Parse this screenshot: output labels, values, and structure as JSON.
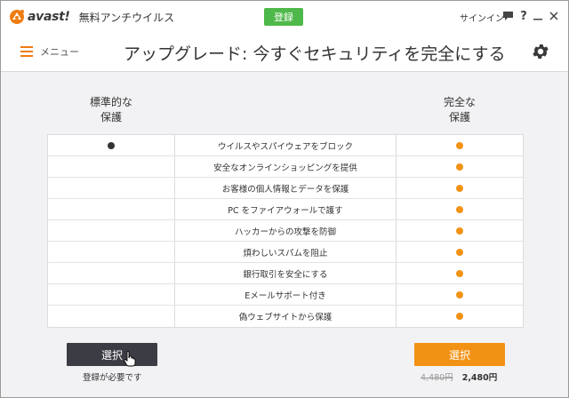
{
  "titlebar": {
    "logo_text": "avast!",
    "product_name": "無料アンチウイルス",
    "register_label": "登録",
    "signin_label": "サインイン",
    "icons": [
      "chat-icon",
      "help-icon",
      "minimize-icon",
      "close-icon"
    ]
  },
  "header": {
    "menu_label": "メニュー",
    "title": "アップグレード: 今すぐセキュリティを完全にする",
    "settings_icon": "gear-icon"
  },
  "columns": {
    "standard": {
      "title_line1": "標準的な",
      "title_line2": "保護"
    },
    "complete": {
      "title_line1": "完全な",
      "title_line2": "保護"
    }
  },
  "features": [
    {
      "label": "ウイルスやスパイウェアをブロック",
      "standard": true,
      "complete": true
    },
    {
      "label": "安全なオンラインショッピングを提供",
      "standard": false,
      "complete": true
    },
    {
      "label": "お客様の個人情報とデータを保護",
      "standard": false,
      "complete": true
    },
    {
      "label": "PC をファイアウォールで護す",
      "standard": false,
      "complete": true
    },
    {
      "label": "ハッカーからの攻撃を防御",
      "standard": false,
      "complete": true
    },
    {
      "label": "煩わしいスパムを阻止",
      "standard": false,
      "complete": true
    },
    {
      "label": "銀行取引を安全にする",
      "standard": false,
      "complete": true
    },
    {
      "label": "Eメールサポート付き",
      "standard": false,
      "complete": true
    },
    {
      "label": "偽ウェブサイトから保護",
      "standard": false,
      "complete": true
    }
  ],
  "actions": {
    "standard_select_label": "選択",
    "standard_note": "登録が必要です",
    "complete_select_label": "選択",
    "old_price": "4,480円",
    "new_price": "2,480円"
  },
  "colors": {
    "accent_orange": "#f29214",
    "register_green": "#4fb84a",
    "dark_button": "#3c3c44"
  }
}
